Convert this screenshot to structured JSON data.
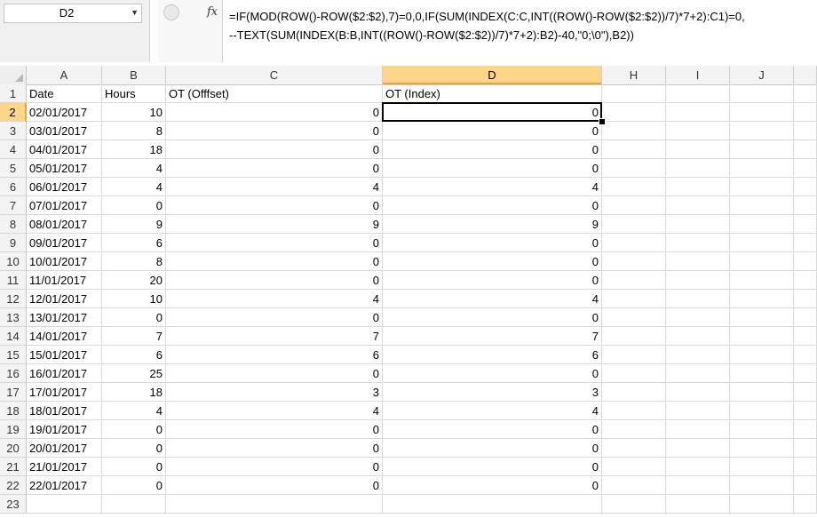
{
  "name_box": {
    "value": "D2"
  },
  "formula_bar": {
    "fx_label": "fx",
    "line1": "=IF(MOD(ROW()-ROW($2:$2),7)=0,0,IF(SUM(INDEX(C:C,INT((ROW()-ROW($2:$2))/7)*7+2):C1)=0,",
    "line2": "--TEXT(SUM(INDEX(B:B,INT((ROW()-ROW($2:$2))/7)*7+2):B2)-40,\"0;\\0\"),B2))"
  },
  "columns": [
    "A",
    "B",
    "C",
    "D",
    "H",
    "I",
    "J"
  ],
  "selected_column": "D",
  "selected_row": 2,
  "header_row": [
    "Date",
    "Hours",
    "OT (Offfset)",
    "OT (Index)"
  ],
  "rows": [
    [
      "02/01/2017",
      "10",
      "0",
      "0"
    ],
    [
      "03/01/2017",
      "8",
      "0",
      "0"
    ],
    [
      "04/01/2017",
      "18",
      "0",
      "0"
    ],
    [
      "05/01/2017",
      "4",
      "0",
      "0"
    ],
    [
      "06/01/2017",
      "4",
      "4",
      "4"
    ],
    [
      "07/01/2017",
      "0",
      "0",
      "0"
    ],
    [
      "08/01/2017",
      "9",
      "9",
      "9"
    ],
    [
      "09/01/2017",
      "6",
      "0",
      "0"
    ],
    [
      "10/01/2017",
      "8",
      "0",
      "0"
    ],
    [
      "11/01/2017",
      "20",
      "0",
      "0"
    ],
    [
      "12/01/2017",
      "10",
      "4",
      "4"
    ],
    [
      "13/01/2017",
      "0",
      "0",
      "0"
    ],
    [
      "14/01/2017",
      "7",
      "7",
      "7"
    ],
    [
      "15/01/2017",
      "6",
      "6",
      "6"
    ],
    [
      "16/01/2017",
      "25",
      "0",
      "0"
    ],
    [
      "17/01/2017",
      "18",
      "3",
      "3"
    ],
    [
      "18/01/2017",
      "4",
      "4",
      "4"
    ],
    [
      "19/01/2017",
      "0",
      "0",
      "0"
    ],
    [
      "20/01/2017",
      "0",
      "0",
      "0"
    ],
    [
      "21/01/2017",
      "0",
      "0",
      "0"
    ],
    [
      "22/01/2017",
      "0",
      "0",
      "0"
    ]
  ],
  "empty_row_number": "23"
}
